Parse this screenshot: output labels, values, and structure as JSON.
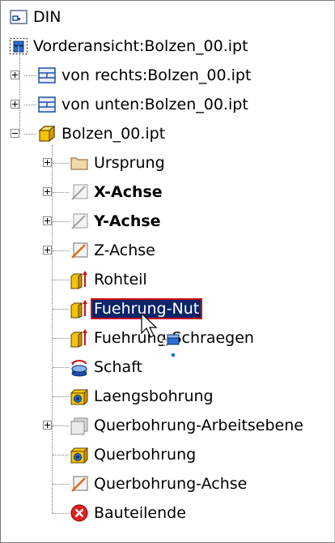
{
  "tree": {
    "root": {
      "label": "DIN",
      "icon": "drawing-sheet-icon"
    },
    "views": [
      {
        "label": "Vorderansicht:Bolzen_00.ipt",
        "icon": "base-view-icon",
        "expandable": false
      },
      {
        "label": "von rechts:Bolzen_00.ipt",
        "icon": "projected-view-icon",
        "expandable": true
      },
      {
        "label": "von unten:Bolzen_00.ipt",
        "icon": "projected-view-icon",
        "expandable": true
      }
    ],
    "part": {
      "label": "Bolzen_00.ipt",
      "icon": "part-icon",
      "expanded": true
    },
    "features": [
      {
        "label": "Ursprung",
        "icon": "folder-icon",
        "expandable": true,
        "bold": false
      },
      {
        "label": "X-Achse",
        "icon": "work-axis-icon",
        "expandable": true,
        "bold": true
      },
      {
        "label": "Y-Achse",
        "icon": "work-axis-icon",
        "expandable": true,
        "bold": true
      },
      {
        "label": "Z-Achse",
        "icon": "work-axis-icon",
        "expandable": true,
        "bold": false
      },
      {
        "label": "Rohteil",
        "icon": "extrusion-icon",
        "expandable": false,
        "bold": false
      },
      {
        "label": "Fuehrung-Nut",
        "icon": "extrusion-icon",
        "expandable": false,
        "bold": false,
        "selected": true
      },
      {
        "label": "Fuehrung-Schraegen",
        "icon": "extrusion-icon",
        "expandable": false,
        "bold": false
      },
      {
        "label": "Schaft",
        "icon": "revolve-icon",
        "expandable": false,
        "bold": false
      },
      {
        "label": "Laengsbohrung",
        "icon": "hole-icon",
        "expandable": false,
        "bold": false
      },
      {
        "label": "Querbohrung-Arbeitsebene",
        "icon": "work-plane-icon",
        "expandable": true,
        "bold": false
      },
      {
        "label": "Querbohrung",
        "icon": "hole-icon",
        "expandable": false,
        "bold": false
      },
      {
        "label": "Querbohrung-Achse",
        "icon": "work-axis-icon",
        "expandable": false,
        "bold": false
      },
      {
        "label": "Bauteilende",
        "icon": "end-of-part-icon",
        "expandable": false,
        "bold": false
      }
    ]
  },
  "colors": {
    "selection_bg": "#0a246a",
    "selection_outline": "#d01010",
    "text": "#000000"
  }
}
